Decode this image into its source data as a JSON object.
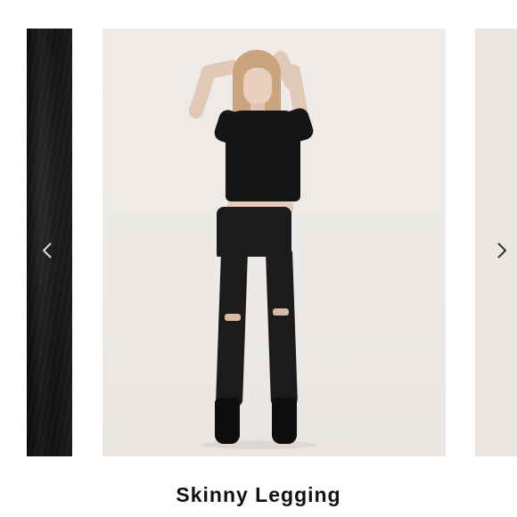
{
  "product": {
    "title": "Skinny Legging"
  },
  "carousel": {
    "prev_icon": "chevron-left-icon",
    "next_icon": "chevron-right-icon",
    "colors": {
      "prev_slide": "#111111",
      "main_slide_bg": "#ece9e6",
      "next_slide": "#e9e6e3",
      "chevron": "#333333"
    }
  }
}
